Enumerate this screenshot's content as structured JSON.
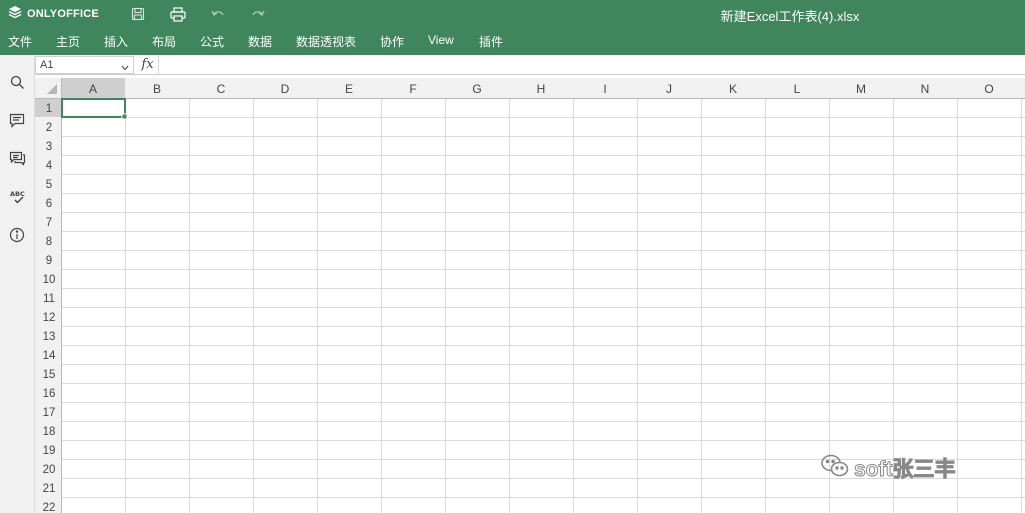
{
  "app": {
    "logo_text": "ONLYOFFICE",
    "document_title": "新建Excel工作表(4).xlsx",
    "accent_color": "#40865c"
  },
  "menu": {
    "items": [
      "文件",
      "主页",
      "插入",
      "布局",
      "公式",
      "数据",
      "数据透视表",
      "协作",
      "View",
      "插件"
    ]
  },
  "formula_bar": {
    "cell_ref": "A1",
    "fx_label": "fx",
    "value": ""
  },
  "sidebar": {
    "icons": [
      "search-icon",
      "comments-icon",
      "chat-icon",
      "spellcheck-icon",
      "info-icon"
    ]
  },
  "sheet": {
    "columns": [
      "A",
      "B",
      "C",
      "D",
      "E",
      "F",
      "G",
      "H",
      "I",
      "J",
      "K",
      "L",
      "M",
      "N",
      "O"
    ],
    "rows": [
      "1",
      "2",
      "3",
      "4",
      "5",
      "6",
      "7",
      "8",
      "9",
      "10",
      "11",
      "12",
      "13",
      "14",
      "15",
      "16",
      "17",
      "18",
      "19",
      "20",
      "21",
      "22"
    ],
    "active_cell": "A1",
    "selection_color": "#40865c"
  },
  "watermark": {
    "text": "soft张三丰"
  }
}
